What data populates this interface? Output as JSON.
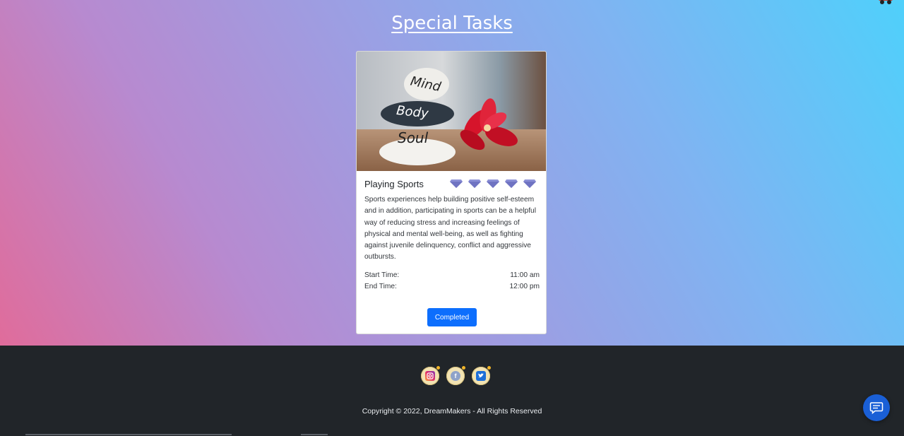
{
  "header": {
    "title": "Special Tasks"
  },
  "card": {
    "image_alt": "Mind Body Soul stones with red flower",
    "stones": [
      "Mind",
      "Body",
      "Soul"
    ],
    "title": "Playing Sports",
    "gem_icon": "diamond-icon",
    "gem_count": 5,
    "description": "Sports experiences help building positive self-esteem and in addition, participating in sports can be a helpful way of reducing stress and increasing feelings of physical and mental well-being, as well as fighting against juvenile delinquency, conflict and aggressive outbursts.",
    "start_label": "Start Time:",
    "start_value": "11:00 am",
    "end_label": "End Time:",
    "end_value": "12:00 pm",
    "button_label": "Completed"
  },
  "footer": {
    "socials": [
      {
        "name": "instagram",
        "icon": "instagram-icon"
      },
      {
        "name": "facebook",
        "icon": "facebook-icon"
      },
      {
        "name": "twitter",
        "icon": "twitter-icon"
      }
    ],
    "copyright": "Copyright © 2022, DreamMakers - All Rights Reserved"
  },
  "chat": {
    "icon": "chat-icon"
  },
  "colors": {
    "primary": "#0d6efd",
    "footer_bg": "#212529",
    "gem": "#8b8fd6"
  }
}
